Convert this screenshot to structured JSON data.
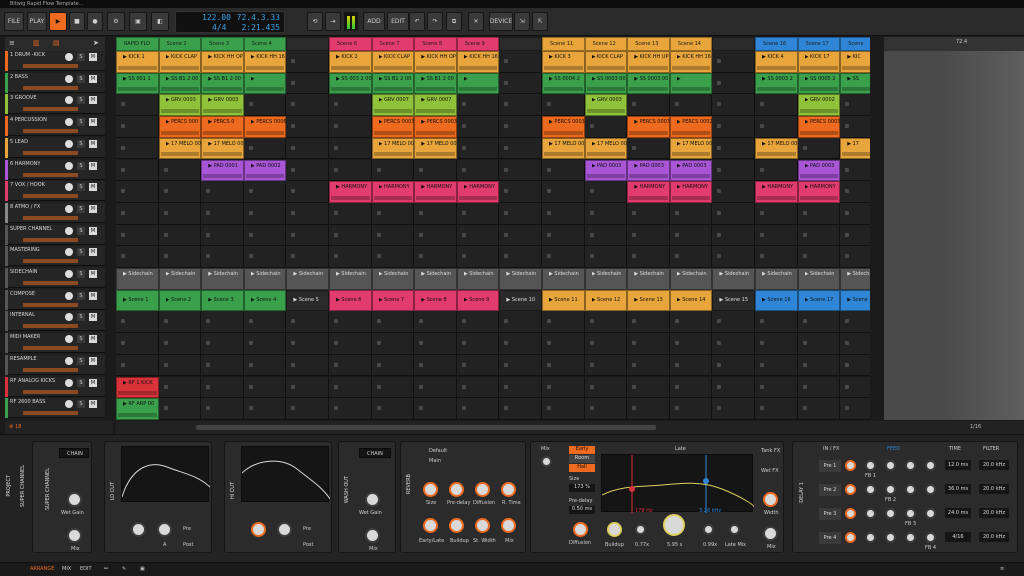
{
  "window": {
    "title": "Bitwig Rapid Flow Template..."
  },
  "toolbar": {
    "file": "FILE",
    "play": "PLAY",
    "add": "ADD",
    "edit": "EDIT",
    "device": "DEVICE",
    "tempo": "122.00",
    "signature": "4/4",
    "position": "72.4.3.33",
    "time": "2:21.435"
  },
  "tracks": [
    {
      "name": "1 DRUM -KICK",
      "color": "#ee6a1f"
    },
    {
      "name": "2 BASS",
      "color": "#3aa04c"
    },
    {
      "name": "3 GROOVE",
      "color": "#8fc23a"
    },
    {
      "name": "4 PERCUSSION",
      "color": "#ee6a1f"
    },
    {
      "name": "5 LEAD",
      "color": "#e7a53c"
    },
    {
      "name": "6 HARMONY",
      "color": "#a855d6"
    },
    {
      "name": "7 VOX / HOOK",
      "color": "#e23b6e"
    },
    {
      "name": "8 ATMO / FX",
      "color": "#888888"
    },
    {
      "name": "SUPER CHANNEL",
      "color": "#555555"
    },
    {
      "name": "MASTERING",
      "color": "#555555"
    },
    {
      "name": "SIDECHAIN",
      "color": "#555555"
    },
    {
      "name": "COMPOSE",
      "color": "#555555"
    },
    {
      "name": "INTERNAL",
      "color": "#555555"
    },
    {
      "name": "MIDI MAKER",
      "color": "#555555"
    },
    {
      "name": "RESAMPLE",
      "color": "#555555"
    },
    {
      "name": "RF ANALOG KICKS",
      "color": "#d8333a"
    },
    {
      "name": "RF 2600 BASS",
      "color": "#3aa04c"
    }
  ],
  "scene_headers": [
    {
      "label": "RAPID FLO",
      "color": "#3aa04c"
    },
    {
      "label": "Scene 2",
      "color": "#3aa04c"
    },
    {
      "label": "Scene 3",
      "color": "#3aa04c"
    },
    {
      "label": "Scene 4",
      "color": "#3aa04c"
    },
    {
      "label": "",
      "color": ""
    },
    {
      "label": "Scene 6",
      "color": "#e23b6e"
    },
    {
      "label": "Scene 7",
      "color": "#e23b6e"
    },
    {
      "label": "Scene 8",
      "color": "#e23b6e"
    },
    {
      "label": "Scene 9",
      "color": "#e23b6e"
    },
    {
      "label": "",
      "color": ""
    },
    {
      "label": "Scene 11",
      "color": "#e7a53c"
    },
    {
      "label": "Scene 12",
      "color": "#e7a53c"
    },
    {
      "label": "Scene 13",
      "color": "#e7a53c"
    },
    {
      "label": "Scene 14",
      "color": "#e7a53c"
    },
    {
      "label": "",
      "color": ""
    },
    {
      "label": "Scene 16",
      "color": "#2f86d6"
    },
    {
      "label": "Scene 17",
      "color": "#2f86d6"
    },
    {
      "label": "Scene",
      "color": "#2f86d6"
    }
  ],
  "compose_scenes": [
    "Scene 1",
    "Scene 2",
    "Scene 3",
    "Scene 4",
    "Scene 5",
    "Scene 6",
    "Scene 7",
    "Scene 8",
    "Scene 9",
    "Scene 10",
    "Scene 11",
    "Scene 12",
    "Scene 13",
    "Scene 14",
    "Scene 15",
    "Scene 16",
    "Scene 17",
    "Scene"
  ],
  "clips": [
    {
      "row": 0,
      "cols": [
        0
      ],
      "label": "KICK 1",
      "color": "#e7a53c"
    },
    {
      "row": 0,
      "cols": [
        1
      ],
      "label": "KICK CLAP",
      "color": "#e7a53c"
    },
    {
      "row": 0,
      "cols": [
        2
      ],
      "label": "KICK HH OP",
      "color": "#e7a53c"
    },
    {
      "row": 0,
      "cols": [
        3
      ],
      "label": "KICK HH 16",
      "color": "#e7a53c"
    },
    {
      "row": 0,
      "cols": [
        5
      ],
      "label": "KICK 2",
      "color": "#e7a53c"
    },
    {
      "row": 0,
      "cols": [
        6
      ],
      "label": "KICK CLAP",
      "color": "#e7a53c"
    },
    {
      "row": 0,
      "cols": [
        7
      ],
      "label": "KICK HH OP",
      "color": "#e7a53c"
    },
    {
      "row": 0,
      "cols": [
        8
      ],
      "label": "KICK HH 16",
      "color": "#e7a53c"
    },
    {
      "row": 0,
      "cols": [
        10
      ],
      "label": "KICK 3",
      "color": "#e7a53c"
    },
    {
      "row": 0,
      "cols": [
        11
      ],
      "label": "KICK CLAP",
      "color": "#e7a53c"
    },
    {
      "row": 0,
      "cols": [
        12
      ],
      "label": "KICK HH UP",
      "color": "#e7a53c"
    },
    {
      "row": 0,
      "cols": [
        13
      ],
      "label": "KICK HH 16",
      "color": "#e7a53c"
    },
    {
      "row": 0,
      "cols": [
        15
      ],
      "label": "KICK 4",
      "color": "#e7a53c"
    },
    {
      "row": 0,
      "cols": [
        16
      ],
      "label": "KICK 17",
      "color": "#e7a53c"
    },
    {
      "row": 0,
      "cols": [
        17
      ],
      "label": "KIC",
      "color": "#e7a53c"
    },
    {
      "row": 1,
      "cols": [
        0
      ],
      "label": "SS 001 1",
      "color": "#3aa04c"
    },
    {
      "row": 1,
      "cols": [
        1
      ],
      "label": "SS B1 2 00",
      "color": "#3aa04c"
    },
    {
      "row": 1,
      "cols": [
        2
      ],
      "label": "SS B1 2 00",
      "color": "#3aa04c"
    },
    {
      "row": 1,
      "cols": [
        3
      ],
      "label": "",
      "color": "#3aa04c"
    },
    {
      "row": 1,
      "cols": [
        5
      ],
      "label": "SS 003 2 00",
      "color": "#3aa04c"
    },
    {
      "row": 1,
      "cols": [
        6
      ],
      "label": "SS B1 2 00",
      "color": "#3aa04c"
    },
    {
      "row": 1,
      "cols": [
        7
      ],
      "label": "SS B1 2 00",
      "color": "#3aa04c"
    },
    {
      "row": 1,
      "cols": [
        8
      ],
      "label": "",
      "color": "#3aa04c"
    },
    {
      "row": 1,
      "cols": [
        10
      ],
      "label": "SS 0004 2",
      "color": "#3aa04c"
    },
    {
      "row": 1,
      "cols": [
        11
      ],
      "label": "SS 0003 00",
      "color": "#3aa04c"
    },
    {
      "row": 1,
      "cols": [
        12
      ],
      "label": "SS 0003 00",
      "color": "#3aa04c"
    },
    {
      "row": 1,
      "cols": [
        13
      ],
      "label": "",
      "color": "#3aa04c"
    },
    {
      "row": 1,
      "cols": [
        15
      ],
      "label": "SS 0003 2",
      "color": "#3aa04c"
    },
    {
      "row": 1,
      "cols": [
        16
      ],
      "label": "SS 0005 2",
      "color": "#3aa04c"
    },
    {
      "row": 1,
      "cols": [
        17
      ],
      "label": "SS",
      "color": "#3aa04c"
    },
    {
      "row": 2,
      "cols": [
        1
      ],
      "label": "GRV 0003",
      "color": "#8fc23a"
    },
    {
      "row": 2,
      "cols": [
        2
      ],
      "label": "GRV 0003",
      "color": "#8fc23a"
    },
    {
      "row": 2,
      "cols": [
        6
      ],
      "label": "GRV 0007",
      "color": "#8fc23a"
    },
    {
      "row": 2,
      "cols": [
        7
      ],
      "label": "GRV 0007",
      "color": "#8fc23a"
    },
    {
      "row": 2,
      "cols": [
        11
      ],
      "label": "GRV 0003",
      "color": "#8fc23a"
    },
    {
      "row": 2,
      "cols": [
        16
      ],
      "label": "GRV 0002",
      "color": "#8fc23a"
    },
    {
      "row": 3,
      "cols": [
        1
      ],
      "label": "PERCS 000",
      "color": "#ee6a1f"
    },
    {
      "row": 3,
      "cols": [
        2
      ],
      "label": "PERCS 0",
      "color": "#ee6a1f"
    },
    {
      "row": 3,
      "cols": [
        3
      ],
      "label": "PERCS 0006",
      "color": "#ee6a1f"
    },
    {
      "row": 3,
      "cols": [
        6
      ],
      "label": "PERCS 0003",
      "color": "#ee6a1f"
    },
    {
      "row": 3,
      "cols": [
        7
      ],
      "label": "PERCS 0003",
      "color": "#ee6a1f"
    },
    {
      "row": 3,
      "cols": [
        10
      ],
      "label": "PERCS 0003",
      "color": "#ee6a1f"
    },
    {
      "row": 3,
      "cols": [
        12
      ],
      "label": "PERCS 0003",
      "color": "#ee6a1f"
    },
    {
      "row": 3,
      "cols": [
        13
      ],
      "label": "PERCS 0002",
      "color": "#ee6a1f"
    },
    {
      "row": 3,
      "cols": [
        16
      ],
      "label": "PERCS 0003",
      "color": "#ee6a1f"
    },
    {
      "row": 4,
      "cols": [
        1
      ],
      "label": "17 MELO 00",
      "color": "#e7a53c"
    },
    {
      "row": 4,
      "cols": [
        2
      ],
      "label": "17 MELO 00",
      "color": "#e7a53c"
    },
    {
      "row": 4,
      "cols": [
        6
      ],
      "label": "17 MELO 00",
      "color": "#e7a53c"
    },
    {
      "row": 4,
      "cols": [
        7
      ],
      "label": "17 MELO 00",
      "color": "#e7a53c"
    },
    {
      "row": 4,
      "cols": [
        10
      ],
      "label": "17 MELO 00",
      "color": "#e7a53c"
    },
    {
      "row": 4,
      "cols": [
        11
      ],
      "label": "17 MELO 00",
      "color": "#e7a53c"
    },
    {
      "row": 4,
      "cols": [
        13
      ],
      "label": "17 MELO 00",
      "color": "#e7a53c"
    },
    {
      "row": 4,
      "cols": [
        15
      ],
      "label": "17 MELO 00",
      "color": "#e7a53c"
    },
    {
      "row": 4,
      "cols": [
        17
      ],
      "label": "17",
      "color": "#e7a53c"
    },
    {
      "row": 5,
      "cols": [
        2
      ],
      "label": "PAD 0001",
      "color": "#a855d6"
    },
    {
      "row": 5,
      "cols": [
        3
      ],
      "label": "PAD 0002",
      "color": "#a855d6"
    },
    {
      "row": 5,
      "cols": [
        11
      ],
      "label": "PAD 0003",
      "color": "#a855d6"
    },
    {
      "row": 5,
      "cols": [
        12
      ],
      "label": "PAD 0003",
      "color": "#a855d6"
    },
    {
      "row": 5,
      "cols": [
        13
      ],
      "label": "PAD 0003",
      "color": "#a855d6"
    },
    {
      "row": 5,
      "cols": [
        16
      ],
      "label": "PAD 0003",
      "color": "#a855d6"
    },
    {
      "row": 6,
      "cols": [
        5
      ],
      "label": "HARMONY",
      "color": "#e23b6e"
    },
    {
      "row": 6,
      "cols": [
        6
      ],
      "label": "HARMONY",
      "color": "#e23b6e"
    },
    {
      "row": 6,
      "cols": [
        7
      ],
      "label": "HARMONY",
      "color": "#e23b6e"
    },
    {
      "row": 6,
      "cols": [
        8
      ],
      "label": "HARMONY",
      "color": "#e23b6e"
    },
    {
      "row": 6,
      "cols": [
        12
      ],
      "label": "HARMONY",
      "color": "#e23b6e"
    },
    {
      "row": 6,
      "cols": [
        13
      ],
      "label": "HARMONY",
      "color": "#e23b6e"
    },
    {
      "row": 6,
      "cols": [
        15
      ],
      "label": "HARMONY",
      "color": "#e23b6e"
    },
    {
      "row": 6,
      "cols": [
        16
      ],
      "label": "HARMONY",
      "color": "#e23b6e"
    },
    {
      "row": 15,
      "cols": [
        0
      ],
      "label": "RF 1 KICK",
      "color": "#d8333a"
    },
    {
      "row": 16,
      "cols": [
        0
      ],
      "label": "RF ARP 00",
      "color": "#3aa04c"
    }
  ],
  "sidechain_label": "Sidechain",
  "right_pane": {
    "position": "72.4"
  },
  "bottom": {
    "arrange": "ARRANGE",
    "mix": "MIX",
    "edit": "EDIT",
    "zoom": "1/16"
  },
  "devices": {
    "project": "PROJECT",
    "super_channel": "SUPER CHANNEL",
    "chain": "CHAIN",
    "wet_gain": "Wet Gain",
    "mix": "Mix",
    "lo_cut": "LO CUT",
    "hi_cut": "HI CUT",
    "pre": "Pre",
    "post": "Post",
    "a": "A",
    "wash_out": "WASH OUT",
    "reverb": "REVERB",
    "default": "Default",
    "main": "Main",
    "size": "Size",
    "predelay": "Pre-delay",
    "diffusion": "Diffusion",
    "rtime": "R. Time",
    "early_late": "Early/Late",
    "buildup": "Buildup",
    "stwidth": "St. Width",
    "early": "Early",
    "room": "Room",
    "hall": "Hall",
    "late": "Late",
    "size_val": "173 %",
    "predelay_val": "0.50 ms",
    "freq_lo": "178 Hz",
    "freq_hi": "3.28 kHz",
    "buildup_val": "0.77x",
    "decay_val": "5.95 s",
    "width_val": "0.99x",
    "latemix": "Late Mix",
    "tank_fx": "Tank FX",
    "wet_fx": "Wet FX",
    "width": "Width",
    "delay": "DELAY 1",
    "infx": "IN / FX",
    "feed": "FEED",
    "time": "TIME",
    "filter": "FILTER",
    "pre_rows": [
      "Pre 1",
      "Pre 2",
      "Pre 3",
      "Pre 4"
    ],
    "fb": [
      "FB 1",
      "FB 2",
      "FB 3",
      "FB 4"
    ],
    "times": [
      "12.0 ms",
      "36.0 ms",
      "24.0 ms",
      "4/16"
    ],
    "filters": [
      "20.0 kHz",
      "20.0 kHz",
      "20.0 kHz",
      "20.0 kHz"
    ]
  }
}
